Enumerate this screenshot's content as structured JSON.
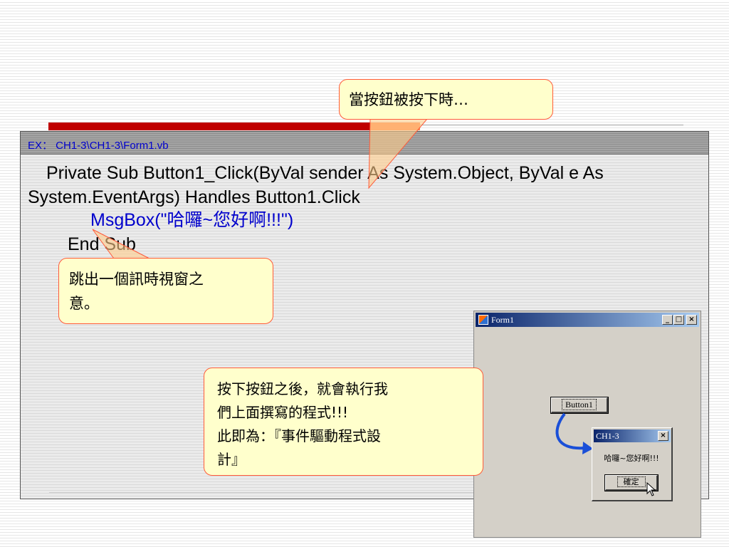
{
  "slide": {
    "code_path": "EX： CH1-3\\CH1-3\\Form1.vb",
    "code_lines": [
      "Private Sub Button1_Click(ByVal sender As System.Object, ByVal e As",
      "System.EventArgs) Handles Button1.Click",
      "MsgBox(\"哈囉~您好啊!!!\")",
      "End Sub"
    ]
  },
  "callouts": {
    "top": "當按鈕被按下時…",
    "left_line1": "跳出一個訊時視窗之",
    "left_line2": "意。",
    "bottom_line1": "按下按鈕之後，就會執行我",
    "bottom_line2": "們上面撰寫的程式!!!",
    "bottom_line3": "此即為：『事件驅動程式設",
    "bottom_line4": "計』"
  },
  "form1": {
    "title": "Form1",
    "button_label": "Button1",
    "minimize": "_",
    "maximize": "□",
    "close": "×"
  },
  "msgbox": {
    "title": "CH1-3",
    "message": "哈囉~您好啊!!!",
    "ok_label": "確定",
    "close": "×"
  },
  "colors": {
    "code_blue": "#0000cc",
    "callout_fill": "#ffffcc",
    "callout_border": "#ff5a3a",
    "accent_red": "#c00000",
    "arrow_blue": "#1a4fd8"
  },
  "icons": [
    "form-app-icon",
    "cursor-icon",
    "curved-arrow-icon"
  ]
}
